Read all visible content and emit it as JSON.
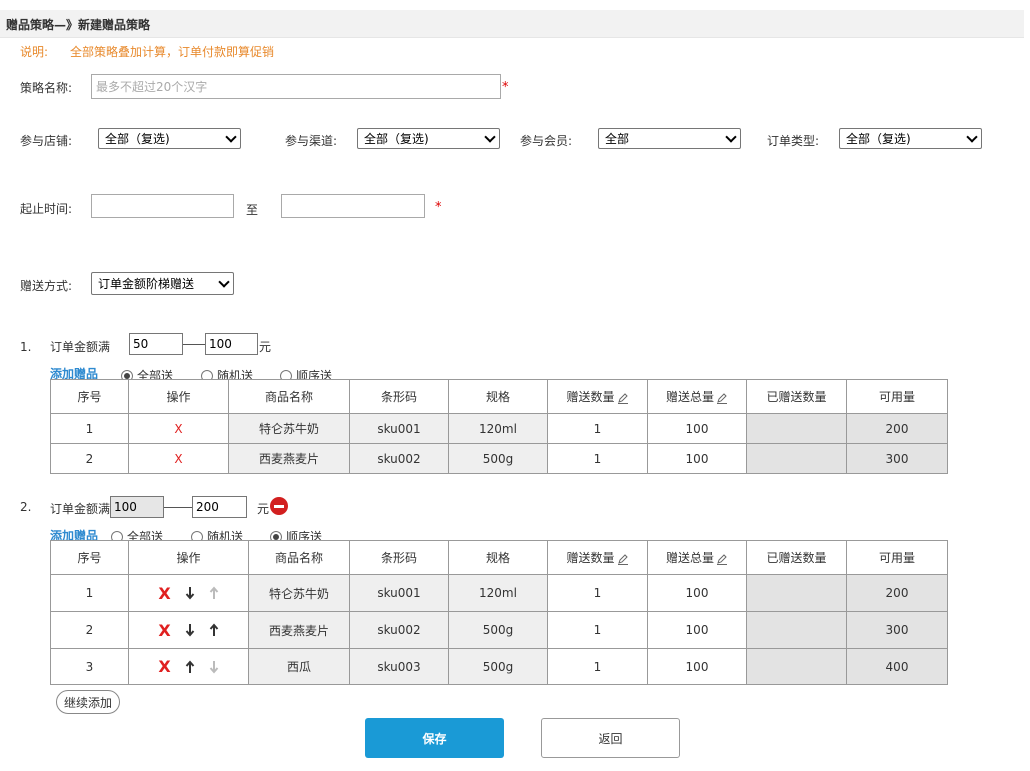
{
  "header": {
    "breadcrumb": "赠品策略—》新建赠品策略"
  },
  "note": {
    "label": "说明:",
    "text": "全部策略叠加计算，订单付款即算促销"
  },
  "form": {
    "name_label": "策略名称:",
    "name_placeholder": "最多不超过20个汉字",
    "required_mark": "*",
    "store_label": "参与店铺:",
    "store_value": "全部（复选)",
    "channel_label": "参与渠道:",
    "channel_value": "全部（复选)",
    "member_label": "参与会员:",
    "member_value": "全部",
    "ordertype_label": "订单类型:",
    "ordertype_value": "全部（复选)",
    "time_label": "起止时间:",
    "time_to": "至",
    "gift_mode_label": "赠送方式:",
    "gift_mode_value": "订单金额阶梯赠送"
  },
  "tiers": [
    {
      "index": "1.",
      "label": "订单金额满",
      "min": "50",
      "max": "100",
      "unit": "元",
      "add_gift": "添加赠品",
      "radios": [
        {
          "label": "全部送",
          "checked": true
        },
        {
          "label": "随机送",
          "checked": false
        },
        {
          "label": "顺序送",
          "checked": false
        }
      ],
      "rows": [
        {
          "seq": "1",
          "op": "X",
          "name": "特仑苏牛奶",
          "barcode": "sku001",
          "spec": "120ml",
          "qty": "1",
          "total": "100",
          "given": "",
          "available": "200"
        },
        {
          "seq": "2",
          "op": "X",
          "name": "西麦燕麦片",
          "barcode": "sku002",
          "spec": "500g",
          "qty": "1",
          "total": "100",
          "given": "",
          "available": "300"
        }
      ]
    },
    {
      "index": "2.",
      "label": "订单金额满",
      "min": "100",
      "max": "200",
      "unit": "元",
      "add_gift": "添加赠品",
      "radios": [
        {
          "label": "全部送",
          "checked": false
        },
        {
          "label": "随机送",
          "checked": false
        },
        {
          "label": "顺序送",
          "checked": true
        }
      ],
      "rows": [
        {
          "seq": "1",
          "op": "X",
          "name": "特仑苏牛奶",
          "barcode": "sku001",
          "spec": "120ml",
          "qty": "1",
          "total": "100",
          "given": "",
          "available": "200",
          "down_enabled": true,
          "up_enabled": false
        },
        {
          "seq": "2",
          "op": "X",
          "name": "西麦燕麦片",
          "barcode": "sku002",
          "spec": "500g",
          "qty": "1",
          "total": "100",
          "given": "",
          "available": "300",
          "down_enabled": true,
          "up_enabled": true
        },
        {
          "seq": "3",
          "op": "X",
          "name": "西瓜",
          "barcode": "sku003",
          "spec": "500g",
          "qty": "1",
          "total": "100",
          "given": "",
          "available": "400",
          "down_enabled": false,
          "up_enabled": true
        }
      ],
      "continue_add": "继续添加"
    }
  ],
  "table_headers": [
    "序号",
    "操作",
    "商品名称",
    "条形码",
    "规格",
    "赠送数量",
    "赠送总量",
    "已赠送数量",
    "可用量"
  ],
  "buttons": {
    "save": "保存",
    "back": "返回"
  },
  "colors": {
    "accent": "#1a9ad6",
    "note": "#e88a2d",
    "delete": "#e02020",
    "required": "#dd0000"
  }
}
